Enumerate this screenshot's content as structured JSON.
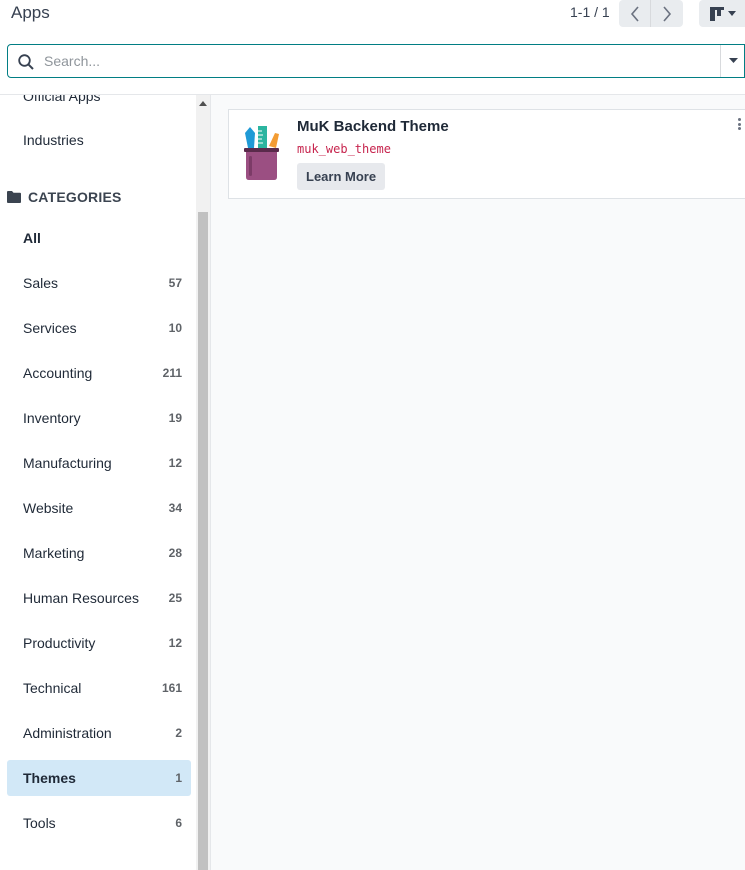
{
  "breadcrumb": {
    "title": "Apps"
  },
  "pager": {
    "value": "1-1 / 1"
  },
  "search": {
    "placeholder": "Search..."
  },
  "sidebar": {
    "top_items": [
      {
        "label": "Official Apps"
      },
      {
        "label": "Industries"
      }
    ],
    "categories_header": "CATEGORIES",
    "categories": [
      {
        "label": "All",
        "count": ""
      },
      {
        "label": "Sales",
        "count": "57"
      },
      {
        "label": "Services",
        "count": "10"
      },
      {
        "label": "Accounting",
        "count": "211"
      },
      {
        "label": "Inventory",
        "count": "19"
      },
      {
        "label": "Manufacturing",
        "count": "12"
      },
      {
        "label": "Website",
        "count": "34"
      },
      {
        "label": "Marketing",
        "count": "28"
      },
      {
        "label": "Human Resources",
        "count": "25"
      },
      {
        "label": "Productivity",
        "count": "12"
      },
      {
        "label": "Technical",
        "count": "161"
      },
      {
        "label": "Administration",
        "count": "2"
      },
      {
        "label": "Themes",
        "count": "1"
      },
      {
        "label": "Tools",
        "count": "6"
      }
    ],
    "selected_category": "Themes"
  },
  "card": {
    "title": "MuK Backend Theme",
    "technical_name": "muk_web_theme",
    "button_label": "Learn More",
    "icon": "pencil-cup-icon"
  },
  "colors": {
    "accent": "#017e84",
    "selected_bg": "#d2e8f7",
    "tech_name": "#c7254e"
  }
}
